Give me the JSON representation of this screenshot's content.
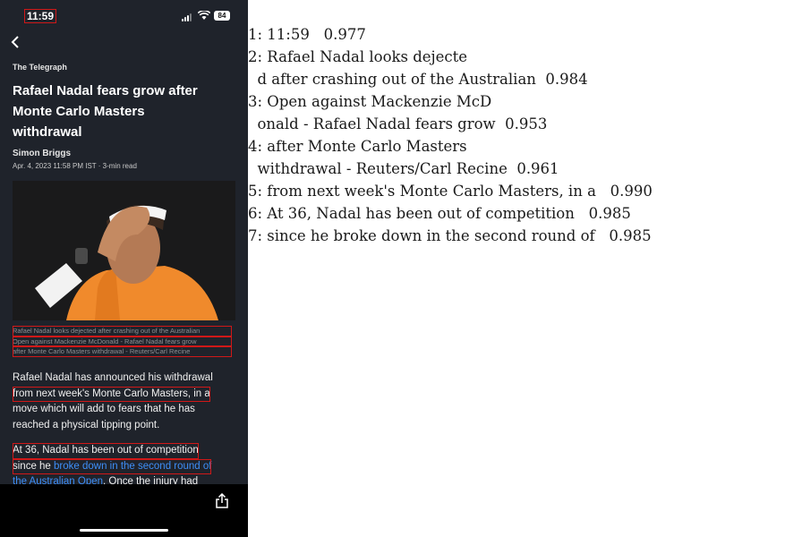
{
  "status_bar": {
    "time": "11:59",
    "battery": "84"
  },
  "article": {
    "publisher": "The Telegraph",
    "headline_lines": [
      "Rafael Nadal fears grow after",
      "Monte Carlo Masters",
      "withdrawal"
    ],
    "author": "Simon Briggs",
    "date": "Apr. 4, 2023 11:58 PM IST",
    "read_time": "3-min read",
    "caption_lines": [
      "Rafael Nadal looks dejected after crashing out of the Australian",
      "Open against Mackenzie McDonald - Rafael Nadal fears grow",
      "after Monte Carlo Masters withdrawal - Reuters/Carl Recine"
    ],
    "para1_lines": [
      "Rafael Nadal has announced his withdrawal",
      "from next week's Monte Carlo Masters, in a",
      "move which will add to fears that he has",
      "reached a physical tipping point."
    ],
    "para2_line1": "At 36, Nadal has been out of competition",
    "para2_line2_prefix": "since he ",
    "para2_line2_link": "broke down in the second round of",
    "para2_line3_link": "the Australian Open",
    "para2_line3_rest": ". Once the injury had"
  },
  "ocr_lines": [
    "1: 11:59   0.977",
    "2: Rafael Nadal looks dejecte",
    "  d after crashing out of the Australian  0.984",
    "3: Open against Mackenzie McD",
    "  onald - Rafael Nadal fears grow  0.953",
    "4: after Monte Carlo Masters",
    "  withdrawal - Reuters/Carl Recine  0.961",
    "5: from next week's Monte Carlo Masters, in a   0.990",
    "6: At 36, Nadal has been out of competition   0.985",
    "7: since he broke down in the second round of   0.985"
  ]
}
